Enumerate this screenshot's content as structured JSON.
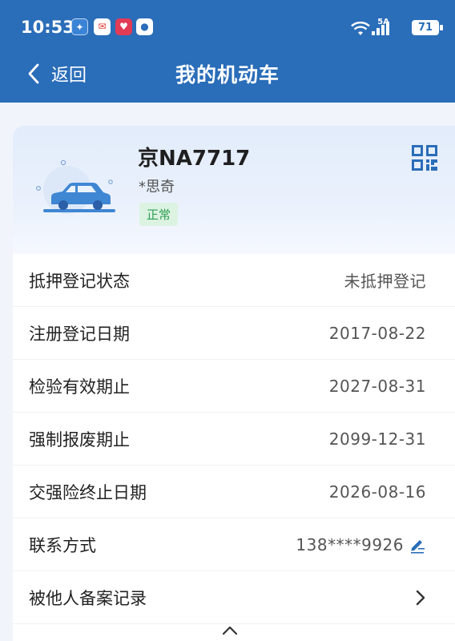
{
  "status_bar": {
    "time": "10:53",
    "network": "5A",
    "battery": "71",
    "app_icons": [
      "lightbulb-app-icon",
      "mail-app-icon",
      "shopping-app-icon",
      "security-app-icon"
    ]
  },
  "header": {
    "back_label": "返回",
    "title": "我的机动车"
  },
  "vehicle": {
    "plate": "京NA7717",
    "owner": "*思奇",
    "status": "正常"
  },
  "details": [
    {
      "label": "抵押登记状态",
      "value": "未抵押登记"
    },
    {
      "label": "注册登记日期",
      "value": "2017-08-22"
    },
    {
      "label": "检验有效期止",
      "value": "2027-08-31"
    },
    {
      "label": "强制报废期止",
      "value": "2099-12-31"
    },
    {
      "label": "交强险终止日期",
      "value": "2026-08-16"
    },
    {
      "label": "联系方式",
      "value": "138****9926"
    },
    {
      "label": "被他人备案记录",
      "value": ""
    }
  ],
  "colors": {
    "header_bg": "#2a6db9",
    "accent": "#2a6db9",
    "status_ok_bg": "#dcf3e2",
    "status_ok_text": "#2f9e53"
  }
}
